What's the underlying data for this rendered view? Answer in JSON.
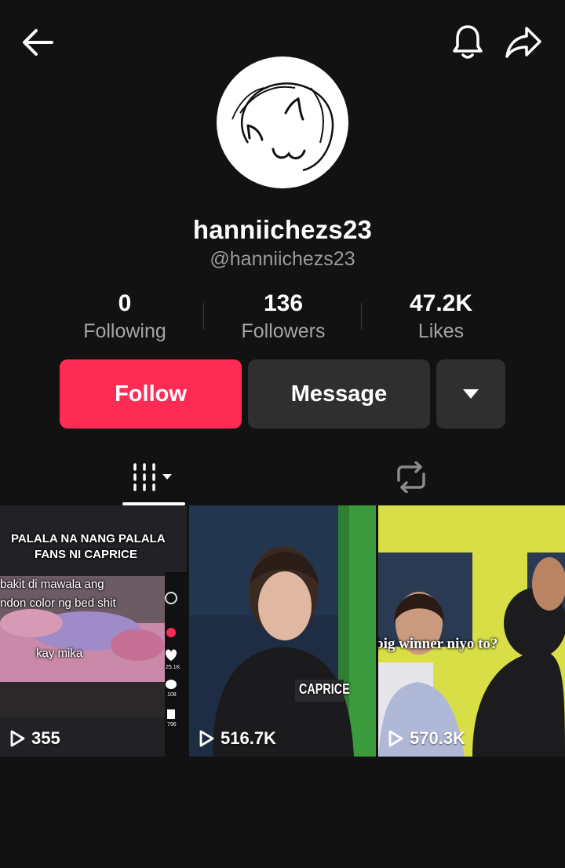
{
  "profile": {
    "display_name": "hanniichezs23",
    "handle": "@hanniichezs23"
  },
  "stats": [
    {
      "value": "0",
      "label": "Following"
    },
    {
      "value": "136",
      "label": "Followers"
    },
    {
      "value": "47.2K",
      "label": "Likes"
    }
  ],
  "actions": {
    "follow_label": "Follow",
    "message_label": "Message"
  },
  "videos": [
    {
      "views": "355",
      "caption_line1": "PALALA NA NANG PALALA",
      "caption_line2": "FANS NI CAPRICE",
      "caption_line3": "bakit di mawala ang",
      "caption_line4": "ndon color ng bed shit",
      "caption_line5": "kay mika",
      "side_count1": "25.1K",
      "side_count2": "108",
      "side_count3": "796"
    },
    {
      "views": "516.7K",
      "jersey_text": "CAPRICE"
    },
    {
      "views": "570.3K",
      "caption": "big winner niyo to?"
    }
  ],
  "colors": {
    "background": "#121212",
    "follow_button": "#fe2c55",
    "secondary_button": "#2f2f2f"
  },
  "icons": [
    "back-arrow-icon",
    "bell-icon",
    "share-icon",
    "chevron-down-icon",
    "grid-videos-icon",
    "repost-icon",
    "play-icon"
  ]
}
